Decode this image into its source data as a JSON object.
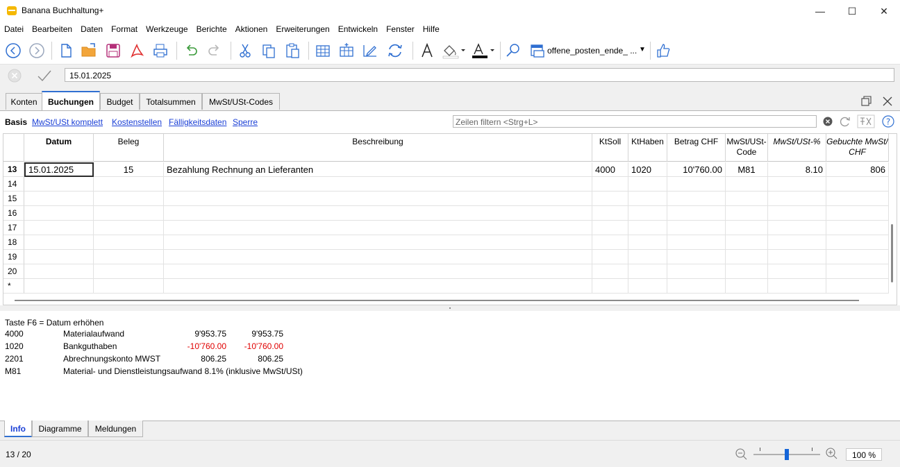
{
  "window": {
    "title": "Banana Buchhaltung+"
  },
  "menu": [
    "Datei",
    "Bearbeiten",
    "Daten",
    "Format",
    "Werkzeuge",
    "Berichte",
    "Aktionen",
    "Erweiterungen",
    "Entwickeln",
    "Fenster",
    "Hilfe"
  ],
  "toolbar": {
    "document_selector": "offene_posten_ende_ ..."
  },
  "editbar": {
    "cell_value": "15.01.2025"
  },
  "tabs": [
    "Konten",
    "Buchungen",
    "Budget",
    "Totalsummen",
    "MwSt/USt-Codes"
  ],
  "active_tab": "Buchungen",
  "views": [
    "Basis",
    "MwSt/USt komplett",
    "Kostenstellen",
    "Fälligkeitsdaten",
    "Sperre"
  ],
  "filter": {
    "placeholder": "Zeilen filtern <Strg+L>"
  },
  "table": {
    "headers": {
      "datum": "Datum",
      "beleg": "Beleg",
      "beschreibung": "Beschreibung",
      "ktsoll": "KtSoll",
      "kthaben": "KtHaben",
      "betrag": "Betrag CHF",
      "mwst_code_1": "MwSt/USt-",
      "mwst_code_2": "Code",
      "mwst_pct": "MwSt/USt-%",
      "gebucht_1": "Gebuchte MwSt/",
      "gebucht_2": "CHF"
    },
    "rows": [
      {
        "nr": "13",
        "datum": "15.01.2025",
        "beleg": "15",
        "beschreibung": "Bezahlung Rechnung an Lieferanten",
        "ktsoll": "4000",
        "kthaben": "1020",
        "betrag": "10'760.00",
        "code": "M81",
        "pct": "8.10",
        "gebucht": "806"
      },
      {
        "nr": "14"
      },
      {
        "nr": "15"
      },
      {
        "nr": "16"
      },
      {
        "nr": "17"
      },
      {
        "nr": "18"
      },
      {
        "nr": "19"
      },
      {
        "nr": "20"
      },
      {
        "nr": "*"
      }
    ]
  },
  "info": {
    "hint": "Taste F6 = Datum erhöhen",
    "lines": [
      {
        "account": "4000",
        "name": "Materialaufwand",
        "v1": "9'953.75",
        "v2": "9'953.75",
        "negative": false
      },
      {
        "account": "1020",
        "name": "Bankguthaben",
        "v1": "-10'760.00",
        "v2": "-10'760.00",
        "negative": true
      },
      {
        "account": "2201",
        "name": "Abrechnungskonto MWST",
        "v1": "806.25",
        "v2": "806.25",
        "negative": false
      },
      {
        "account": "M81",
        "name": "Material- und Dienstleistungsaufwand 8.1% (inklusive MwSt/USt)",
        "v1": "",
        "v2": "",
        "negative": false
      }
    ]
  },
  "bottom_tabs": [
    "Info",
    "Diagramme",
    "Meldungen"
  ],
  "status": {
    "position": "13 / 20",
    "zoom": "100 %"
  },
  "colors": {
    "accent": "#2f6fd1",
    "link": "#1a3fd6",
    "negative": "#e00000"
  }
}
